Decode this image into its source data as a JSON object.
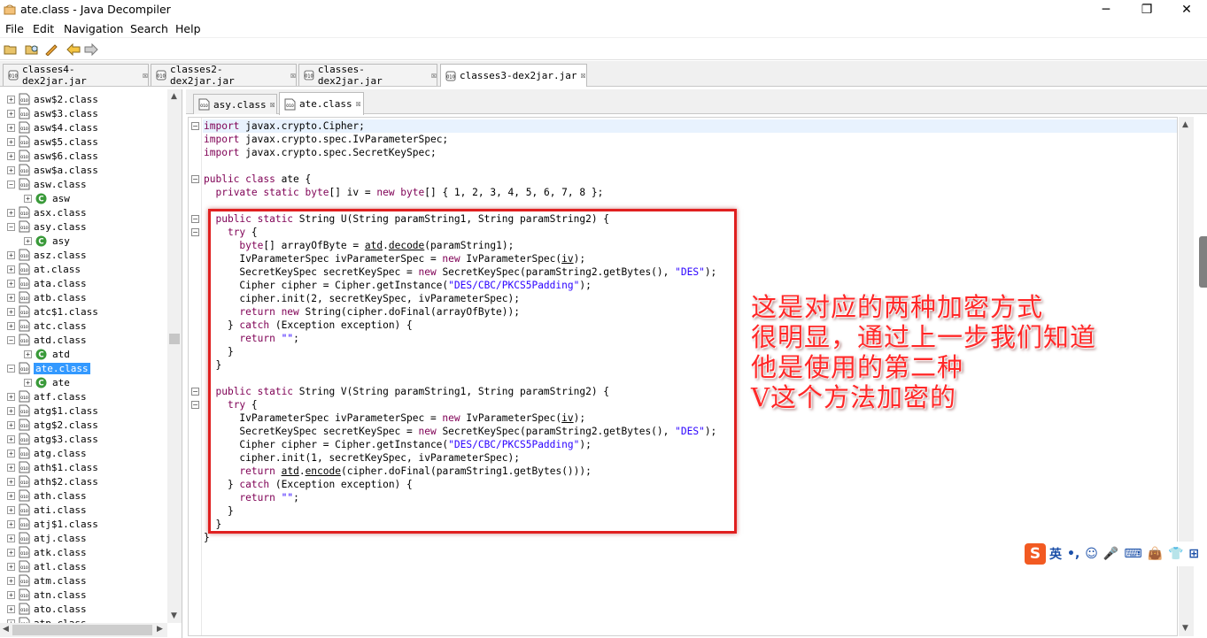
{
  "window": {
    "title": "ate.class - Java Decompiler",
    "controls": [
      "─",
      "❐",
      "✕"
    ]
  },
  "menu": [
    "File",
    "Edit",
    "Navigation",
    "Search",
    "Help"
  ],
  "file_tabs": [
    {
      "label": "classes4-dex2jar.jar",
      "active": false
    },
    {
      "label": "classes2-dex2jar.jar",
      "active": false
    },
    {
      "label": "classes-dex2jar.jar",
      "active": false
    },
    {
      "label": "classes3-dex2jar.jar",
      "active": true
    }
  ],
  "tree": [
    {
      "label": "asw$2.class",
      "type": "class",
      "expanded": false
    },
    {
      "label": "asw$3.class",
      "type": "class",
      "expanded": false
    },
    {
      "label": "asw$4.class",
      "type": "class",
      "expanded": false
    },
    {
      "label": "asw$5.class",
      "type": "class",
      "expanded": false
    },
    {
      "label": "asw$6.class",
      "type": "class",
      "expanded": false
    },
    {
      "label": "asw$a.class",
      "type": "class",
      "expanded": false
    },
    {
      "label": "asw.class",
      "type": "class",
      "expanded": true
    },
    {
      "label": "asw",
      "type": "member"
    },
    {
      "label": "asx.class",
      "type": "class",
      "expanded": false
    },
    {
      "label": "asy.class",
      "type": "class",
      "expanded": true
    },
    {
      "label": "asy",
      "type": "member"
    },
    {
      "label": "asz.class",
      "type": "class",
      "expanded": false
    },
    {
      "label": "at.class",
      "type": "class",
      "expanded": false
    },
    {
      "label": "ata.class",
      "type": "class",
      "expanded": false
    },
    {
      "label": "atb.class",
      "type": "class",
      "expanded": false
    },
    {
      "label": "atc$1.class",
      "type": "class",
      "expanded": false
    },
    {
      "label": "atc.class",
      "type": "class",
      "expanded": false
    },
    {
      "label": "atd.class",
      "type": "class",
      "expanded": true
    },
    {
      "label": "atd",
      "type": "member"
    },
    {
      "label": "ate.class",
      "type": "class",
      "expanded": true,
      "selected": true
    },
    {
      "label": "ate",
      "type": "member"
    },
    {
      "label": "atf.class",
      "type": "class",
      "expanded": false
    },
    {
      "label": "atg$1.class",
      "type": "class",
      "expanded": false
    },
    {
      "label": "atg$2.class",
      "type": "class",
      "expanded": false
    },
    {
      "label": "atg$3.class",
      "type": "class",
      "expanded": false
    },
    {
      "label": "atg.class",
      "type": "class",
      "expanded": false
    },
    {
      "label": "ath$1.class",
      "type": "class",
      "expanded": false
    },
    {
      "label": "ath$2.class",
      "type": "class",
      "expanded": false
    },
    {
      "label": "ath.class",
      "type": "class",
      "expanded": false
    },
    {
      "label": "ati.class",
      "type": "class",
      "expanded": false
    },
    {
      "label": "atj$1.class",
      "type": "class",
      "expanded": false
    },
    {
      "label": "atj.class",
      "type": "class",
      "expanded": false
    },
    {
      "label": "atk.class",
      "type": "class",
      "expanded": false
    },
    {
      "label": "atl.class",
      "type": "class",
      "expanded": false
    },
    {
      "label": "atm.class",
      "type": "class",
      "expanded": false
    },
    {
      "label": "atn.class",
      "type": "class",
      "expanded": false
    },
    {
      "label": "ato.class",
      "type": "class",
      "expanded": false
    },
    {
      "label": "atp.class",
      "type": "class",
      "expanded": false
    }
  ],
  "class_tabs": [
    {
      "label": "asy.class",
      "active": false
    },
    {
      "label": "ate.class",
      "active": true
    }
  ],
  "code": [
    {
      "line": 1,
      "segs": [
        [
          "kw",
          "import"
        ],
        [
          "t",
          " javax.crypto.Cipher;"
        ]
      ]
    },
    {
      "line": 2,
      "segs": [
        [
          "kw",
          "import"
        ],
        [
          "t",
          " javax.crypto.spec.IvParameterSpec;"
        ]
      ]
    },
    {
      "line": 3,
      "segs": [
        [
          "kw",
          "import"
        ],
        [
          "t",
          " javax.crypto.spec.SecretKeySpec;"
        ]
      ]
    },
    {
      "line": 5,
      "segs": [
        [
          "kw",
          "public class"
        ],
        [
          "t",
          " ate {"
        ]
      ]
    },
    {
      "line": 6,
      "segs": [
        [
          "t",
          "  "
        ],
        [
          "kw",
          "private static byte"
        ],
        [
          "t",
          "[] iv = "
        ],
        [
          "kw",
          "new byte"
        ],
        [
          "t",
          "[] { 1, 2, 3, 4, 5, 6, 7, 8 };"
        ]
      ]
    },
    {
      "line": 8,
      "segs": [
        [
          "t",
          "  "
        ],
        [
          "kw",
          "public static"
        ],
        [
          "t",
          " String U(String paramString1, String paramString2) {"
        ]
      ]
    },
    {
      "line": 9,
      "segs": [
        [
          "t",
          "    "
        ],
        [
          "kw",
          "try"
        ],
        [
          "t",
          " {"
        ]
      ]
    },
    {
      "line": 10,
      "segs": [
        [
          "t",
          "      "
        ],
        [
          "kw",
          "byte"
        ],
        [
          "t",
          "[] arrayOfByte = "
        ],
        [
          "ul",
          "atd"
        ],
        [
          "t",
          "."
        ],
        [
          "ul",
          "decode"
        ],
        [
          "t",
          "(paramString1);"
        ]
      ]
    },
    {
      "line": 11,
      "segs": [
        [
          "t",
          "      IvParameterSpec ivParameterSpec = "
        ],
        [
          "kw",
          "new"
        ],
        [
          "t",
          " IvParameterSpec("
        ],
        [
          "ul",
          "iv"
        ],
        [
          "t",
          ");"
        ]
      ]
    },
    {
      "line": 12,
      "segs": [
        [
          "t",
          "      SecretKeySpec secretKeySpec = "
        ],
        [
          "kw",
          "new"
        ],
        [
          "t",
          " SecretKeySpec(paramString2.getBytes(), "
        ],
        [
          "str",
          "\"DES\""
        ],
        [
          "t",
          ");"
        ]
      ]
    },
    {
      "line": 13,
      "segs": [
        [
          "t",
          "      Cipher cipher = Cipher.getInstance("
        ],
        [
          "str",
          "\"DES/CBC/PKCS5Padding\""
        ],
        [
          "t",
          ");"
        ]
      ]
    },
    {
      "line": 14,
      "segs": [
        [
          "t",
          "      cipher.init(2, secretKeySpec, ivParameterSpec);"
        ]
      ]
    },
    {
      "line": 15,
      "segs": [
        [
          "t",
          "      "
        ],
        [
          "kw",
          "return new"
        ],
        [
          "t",
          " String(cipher.doFinal(arrayOfByte));"
        ]
      ]
    },
    {
      "line": 16,
      "segs": [
        [
          "t",
          "    } "
        ],
        [
          "kw",
          "catch"
        ],
        [
          "t",
          " (Exception exception) {"
        ]
      ]
    },
    {
      "line": 17,
      "segs": [
        [
          "t",
          "      "
        ],
        [
          "kw",
          "return"
        ],
        [
          "t",
          " "
        ],
        [
          "str",
          "\"\""
        ],
        [
          "t",
          ";"
        ]
      ]
    },
    {
      "line": 18,
      "segs": [
        [
          "t",
          "    }"
        ]
      ]
    },
    {
      "line": 19,
      "segs": [
        [
          "t",
          "  }"
        ]
      ]
    },
    {
      "line": 21,
      "segs": [
        [
          "t",
          "  "
        ],
        [
          "kw",
          "public static"
        ],
        [
          "t",
          " String V(String paramString1, String paramString2) {"
        ]
      ]
    },
    {
      "line": 22,
      "segs": [
        [
          "t",
          "    "
        ],
        [
          "kw",
          "try"
        ],
        [
          "t",
          " {"
        ]
      ]
    },
    {
      "line": 23,
      "segs": [
        [
          "t",
          "      IvParameterSpec ivParameterSpec = "
        ],
        [
          "kw",
          "new"
        ],
        [
          "t",
          " IvParameterSpec("
        ],
        [
          "ul",
          "iv"
        ],
        [
          "t",
          ");"
        ]
      ]
    },
    {
      "line": 24,
      "segs": [
        [
          "t",
          "      SecretKeySpec secretKeySpec = "
        ],
        [
          "kw",
          "new"
        ],
        [
          "t",
          " SecretKeySpec(paramString2.getBytes(), "
        ],
        [
          "str",
          "\"DES\""
        ],
        [
          "t",
          ");"
        ]
      ]
    },
    {
      "line": 25,
      "segs": [
        [
          "t",
          "      Cipher cipher = Cipher.getInstance("
        ],
        [
          "str",
          "\"DES/CBC/PKCS5Padding\""
        ],
        [
          "t",
          ");"
        ]
      ]
    },
    {
      "line": 26,
      "segs": [
        [
          "t",
          "      cipher.init(1, secretKeySpec, ivParameterSpec);"
        ]
      ]
    },
    {
      "line": 27,
      "segs": [
        [
          "t",
          "      "
        ],
        [
          "kw",
          "return"
        ],
        [
          "t",
          " "
        ],
        [
          "ul",
          "atd"
        ],
        [
          "t",
          "."
        ],
        [
          "ul",
          "encode"
        ],
        [
          "t",
          "(cipher.doFinal(paramString1.getBytes()));"
        ]
      ]
    },
    {
      "line": 28,
      "segs": [
        [
          "t",
          "    } "
        ],
        [
          "kw",
          "catch"
        ],
        [
          "t",
          " (Exception exception) {"
        ]
      ]
    },
    {
      "line": 29,
      "segs": [
        [
          "t",
          "      "
        ],
        [
          "kw",
          "return"
        ],
        [
          "t",
          " "
        ],
        [
          "str",
          "\"\""
        ],
        [
          "t",
          ";"
        ]
      ]
    },
    {
      "line": 30,
      "segs": [
        [
          "t",
          "    }"
        ]
      ]
    },
    {
      "line": 31,
      "segs": [
        [
          "t",
          "  }"
        ]
      ]
    },
    {
      "line": 32,
      "segs": [
        [
          "t",
          "}"
        ]
      ]
    }
  ],
  "fold_lines": [
    1,
    5,
    8,
    9,
    21,
    22
  ],
  "annotation": {
    "lines": [
      "这是对应的两种加密方式",
      "很明显，通过上一步我们知道",
      "他是使用的第二种",
      "V这个方法加密的"
    ],
    "color": "#ff2828"
  },
  "ime": {
    "logo": "S",
    "items": [
      "英",
      "•,",
      "☺",
      "🎤",
      "⌨",
      "👜",
      "👕",
      "⊞"
    ]
  },
  "colors": {
    "keyword": "#7f0055",
    "string": "#2a00ff",
    "selection": "#3399ff",
    "highlight_box": "#e02020"
  }
}
